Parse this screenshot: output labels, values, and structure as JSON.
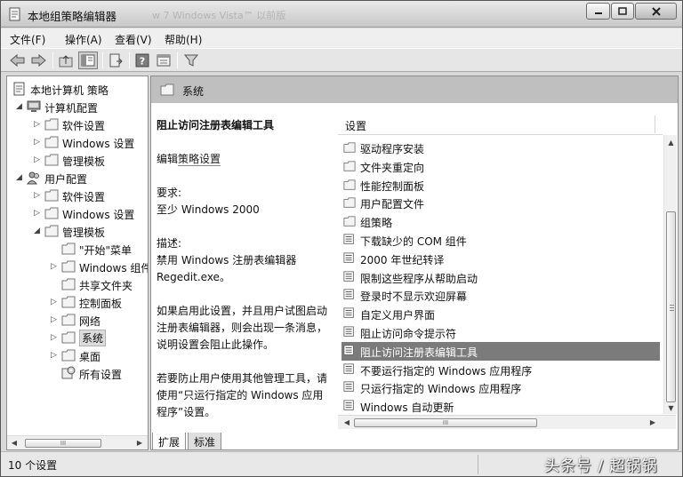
{
  "window": {
    "title": "本地组策略编辑器",
    "ghost_title": "w  7  Windows Vista™ 以前版",
    "minimize_glyph": "—",
    "maximize_glyph": "☐",
    "close_glyph": "✕"
  },
  "menubar": {
    "items": [
      "文件(F)",
      "操作(A)",
      "查看(V)",
      "帮助(H)"
    ]
  },
  "toolbar": {
    "icons": [
      "back-arrow-icon",
      "forward-arrow-icon",
      "up-folder-icon",
      "show-hide-tree-icon",
      "export-list-icon",
      "help-icon",
      "extended-view-icon",
      "filter-icon"
    ]
  },
  "tree": {
    "items": [
      {
        "label": "本地计算机 策略",
        "level": 0,
        "expander": "",
        "icon": "policy-doc-icon"
      },
      {
        "label": "计算机配置",
        "level": 1,
        "expander": "◢",
        "icon": "computer-icon"
      },
      {
        "label": "软件设置",
        "level": 2,
        "expander": "▷",
        "icon": "folder-icon"
      },
      {
        "label": "Windows 设置",
        "level": 2,
        "expander": "▷",
        "icon": "folder-icon"
      },
      {
        "label": "管理模板",
        "level": 2,
        "expander": "▷",
        "icon": "folder-icon"
      },
      {
        "label": "用户配置",
        "level": 1,
        "expander": "◢",
        "icon": "users-icon"
      },
      {
        "label": "软件设置",
        "level": 2,
        "expander": "▷",
        "icon": "folder-icon"
      },
      {
        "label": "Windows 设置",
        "level": 2,
        "expander": "▷",
        "icon": "folder-icon"
      },
      {
        "label": "管理模板",
        "level": 2,
        "expander": "◢",
        "icon": "folder-icon"
      },
      {
        "label": "\"开始\"菜单",
        "level": 3,
        "expander": "",
        "icon": "folder-icon"
      },
      {
        "label": "Windows 组件",
        "level": 3,
        "expander": "▷",
        "icon": "folder-icon"
      },
      {
        "label": "共享文件夹",
        "level": 3,
        "expander": "",
        "icon": "folder-icon"
      },
      {
        "label": "控制面板",
        "level": 3,
        "expander": "▷",
        "icon": "folder-icon"
      },
      {
        "label": "网络",
        "level": 3,
        "expander": "▷",
        "icon": "folder-icon"
      },
      {
        "label": "系统",
        "level": 3,
        "expander": "▷",
        "icon": "folder-icon",
        "selected": true
      },
      {
        "label": "桌面",
        "level": 3,
        "expander": "▷",
        "icon": "folder-icon"
      },
      {
        "label": "所有设置",
        "level": 3,
        "expander": "",
        "icon": "all-settings-icon"
      }
    ]
  },
  "scrollbar": {
    "left_glyph": "◀",
    "right_glyph": "▶",
    "up_glyph": "▲",
    "down_glyph": "▼",
    "grip": "III"
  },
  "header": {
    "label": "系统"
  },
  "description": {
    "title": "阻止访问注册表编辑工具",
    "edit_prefix": "编辑",
    "edit_link": "策略设置",
    "requirements_label": "要求:",
    "requirements_value": "至少 Windows 2000",
    "desc_label": "描述:",
    "desc_line1": "禁用 Windows 注册表编辑器",
    "desc_line2": "Regedit.exe。",
    "para2_line1": "如果启用此设置，并且用户试图启动",
    "para2_line2": "注册表编辑器，则会出现一条消息，",
    "para2_line3": "说明设置会阻止此操作。",
    "para3_line1": "若要防止用户使用其他管理工具，请",
    "para3_line2": "使用“只运行指定的 Windows 应用",
    "para3_line3": "程序”设置。"
  },
  "settings": {
    "column_header": "设置",
    "items": [
      {
        "label": "驱动程序安装",
        "icon": "folder-icon"
      },
      {
        "label": "文件夹重定向",
        "icon": "folder-icon"
      },
      {
        "label": "性能控制面板",
        "icon": "folder-icon"
      },
      {
        "label": "用户配置文件",
        "icon": "folder-icon"
      },
      {
        "label": "组策略",
        "icon": "folder-icon"
      },
      {
        "label": "下载缺少的 COM 组件",
        "icon": "setting-icon"
      },
      {
        "label": "2000 年世纪转译",
        "icon": "setting-icon"
      },
      {
        "label": "限制这些程序从帮助启动",
        "icon": "setting-icon"
      },
      {
        "label": "登录时不显示欢迎屏幕",
        "icon": "setting-icon"
      },
      {
        "label": "自定义用户界面",
        "icon": "setting-icon"
      },
      {
        "label": "阻止访问命令提示符",
        "icon": "setting-icon"
      },
      {
        "label": "阻止访问注册表编辑工具",
        "icon": "setting-icon",
        "selected": true
      },
      {
        "label": "不要运行指定的 Windows 应用程序",
        "icon": "setting-icon"
      },
      {
        "label": "只运行指定的 Windows 应用程序",
        "icon": "setting-icon"
      },
      {
        "label": "Windows 自动更新",
        "icon": "setting-icon"
      }
    ]
  },
  "tabs": {
    "extended": "扩展",
    "standard": "标准"
  },
  "status": {
    "text": "10 个设置"
  },
  "watermark": "头条号 / 超锅锅"
}
